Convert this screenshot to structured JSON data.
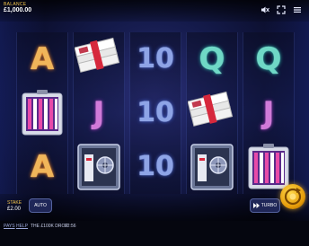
{
  "balance": {
    "label": "BALANCE",
    "value": "£1,000.00"
  },
  "top_icons": [
    {
      "name": "mute-icon"
    },
    {
      "name": "fullscreen-icon"
    },
    {
      "name": "menu-icon"
    }
  ],
  "reels": [
    [
      "A",
      "cash-case",
      "A"
    ],
    [
      "cash-stack",
      "J",
      "vault"
    ],
    [
      "10",
      "10",
      "10"
    ],
    [
      "Q",
      "cash-stack",
      "vault"
    ],
    [
      "Q",
      "J",
      "cash-case"
    ]
  ],
  "stake": {
    "label": "STAKE",
    "value": "£2.00"
  },
  "auto_label": "AUTO",
  "turbo_label": "TURBO",
  "spin_icon": "spin-icon",
  "footer": {
    "pays": "PAYS",
    "help": "HELP",
    "game_name": "THE £100K DROP",
    "time": "12:56"
  },
  "colors": {
    "accent_gold": "#f3c44a",
    "spin_orange": "#e49a08"
  }
}
